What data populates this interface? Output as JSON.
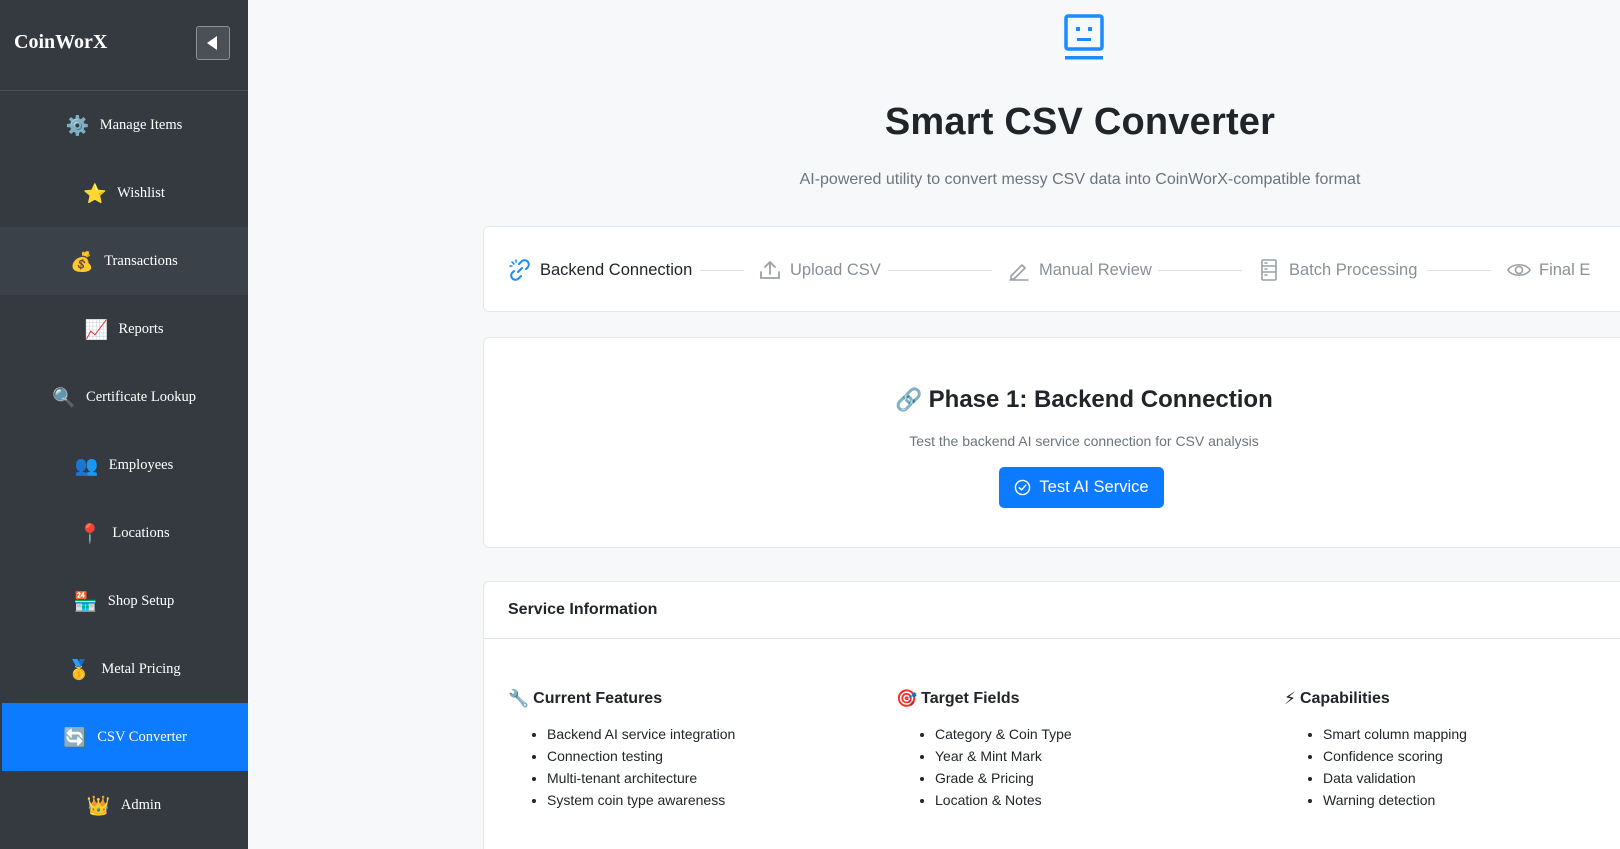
{
  "sidebar": {
    "brand": "CoinWorX",
    "items": [
      {
        "icon": "⚙️",
        "label": "Manage Items"
      },
      {
        "icon": "⭐",
        "label": "Wishlist"
      },
      {
        "icon": "💰",
        "label": "Transactions"
      },
      {
        "icon": "📈",
        "label": "Reports"
      },
      {
        "icon": "🔍",
        "label": "Certificate Lookup"
      },
      {
        "icon": "👥",
        "label": "Employees"
      },
      {
        "icon": "📍",
        "label": "Locations"
      },
      {
        "icon": "🏪",
        "label": "Shop Setup"
      },
      {
        "icon": "🥇",
        "label": "Metal Pricing"
      },
      {
        "icon": "🔄",
        "label": "CSV Converter"
      },
      {
        "icon": "👑",
        "label": "Admin"
      }
    ]
  },
  "header": {
    "title": "Smart CSV Converter",
    "subtitle": "AI-powered utility to convert messy CSV data into CoinWorX-compatible format"
  },
  "steps": [
    {
      "label": "Backend Connection"
    },
    {
      "label": "Upload CSV"
    },
    {
      "label": "Manual Review"
    },
    {
      "label": "Batch Processing"
    },
    {
      "label": "Final E"
    }
  ],
  "phase": {
    "icon": "🔗",
    "title": "Phase 1: Backend Connection",
    "description": "Test the backend AI service connection for CSV analysis",
    "button_label": "Test AI Service"
  },
  "info": {
    "title": "Service Information",
    "columns": [
      {
        "icon": "🔧",
        "title": "Current Features",
        "items": [
          "Backend AI service integration",
          "Connection testing",
          "Multi-tenant architecture",
          "System coin type awareness"
        ]
      },
      {
        "icon": "🎯",
        "title": "Target Fields",
        "items": [
          "Category & Coin Type",
          "Year & Mint Mark",
          "Grade & Pricing",
          "Location & Notes"
        ]
      },
      {
        "icon": "⚡",
        "title": "Capabilities",
        "items": [
          "Smart column mapping",
          "Confidence scoring",
          "Data validation",
          "Warning detection"
        ]
      }
    ]
  },
  "colors": {
    "sidebar_bg": "#343a40",
    "accent": "#0d7bff",
    "page_bg": "#f7f8fa"
  }
}
